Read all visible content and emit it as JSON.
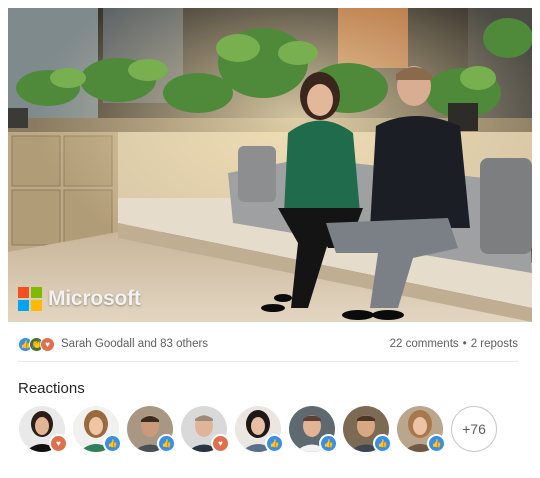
{
  "post": {
    "image_caption_logo": "Microsoft"
  },
  "social": {
    "reactor_text": "Sarah Goodall and 83 others",
    "comments": "22 comments",
    "separator": "•",
    "reposts": "2 reposts"
  },
  "reactions": {
    "title": "Reactions",
    "reaction_types": [
      "like",
      "celebrate",
      "love"
    ],
    "more_count": "+76",
    "people": [
      {
        "reaction": "love"
      },
      {
        "reaction": "like"
      },
      {
        "reaction": "like"
      },
      {
        "reaction": "love"
      },
      {
        "reaction": "like"
      },
      {
        "reaction": "like"
      },
      {
        "reaction": "like"
      },
      {
        "reaction": "like"
      }
    ]
  },
  "colors": {
    "like": "#378fe9",
    "celebrate": "#44712e",
    "love": "#df704d",
    "ms_red": "#f25022",
    "ms_green": "#7fba00",
    "ms_blue": "#00a4ef",
    "ms_yellow": "#ffb900"
  }
}
